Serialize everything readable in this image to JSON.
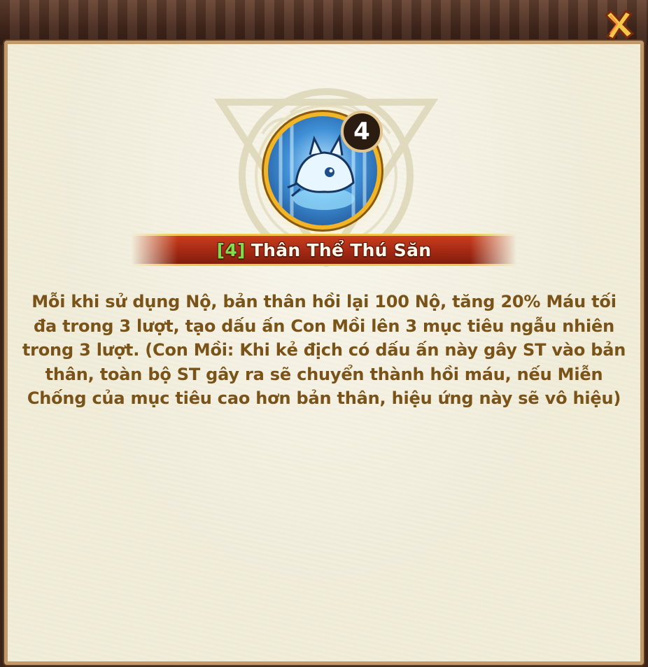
{
  "skill": {
    "level": "4",
    "title_level": "[4]",
    "title_name": "Thân Thể Thú Săn",
    "description": "Mỗi khi sử dụng Nộ, bản thân hồi lại 100 Nộ, tăng 20% Máu tối đa trong 3 lượt, tạo dấu ấn Con Mồi lên 3 mục tiêu ngẫu nhiên trong 3 lượt. (Con Mồi: Khi kẻ địch có dấu ấn này gây ST vào bản thân, toàn bộ ST gây ra sẽ chuyển thành hồi máu, nếu Miễn Chống của mục tiêu cao hơn bản thân, hiệu ứng này sẽ vô hiệu)",
    "icon": "boar-skill-icon"
  },
  "window": {
    "close_icon": "close-icon"
  },
  "colors": {
    "description_text": "#7a5318",
    "title_level": "#7fdc4a",
    "title_text": "#fff8ea",
    "banner": "#a82a14",
    "panel": "#f1eddb",
    "badge_bg": "#2b1c12"
  }
}
